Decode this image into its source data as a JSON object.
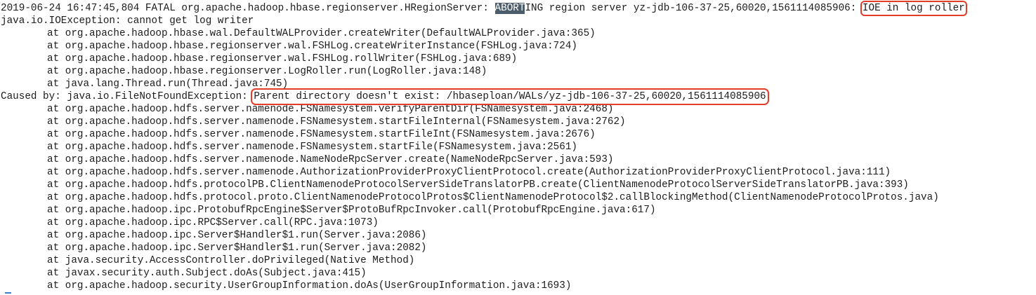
{
  "terminal": {
    "header": {
      "prefix": "2019-06-24 16:47:45,804 FATAL org.apache.hadoop.hbase.regionserver.HRegionServer: ",
      "selected": "ABORT",
      "middle": "ING region server yz-jdb-106-37-25,60020,1561114085906: ",
      "highlighted": "IOE in log roller"
    },
    "exception": "java.io.IOException: cannot get log writer",
    "trace1": [
      "at org.apache.hadoop.hbase.wal.DefaultWALProvider.createWriter(DefaultWALProvider.java:365)",
      "at org.apache.hadoop.hbase.regionserver.wal.FSHLog.createWriterInstance(FSHLog.java:724)",
      "at org.apache.hadoop.hbase.regionserver.wal.FSHLog.rollWriter(FSHLog.java:689)",
      "at org.apache.hadoop.hbase.regionserver.LogRoller.run(LogRoller.java:148)",
      "at java.lang.Thread.run(Thread.java:745)"
    ],
    "caused_by": {
      "prefix": "Caused by: java.io.FileNotFoundException: ",
      "highlighted": "Parent directory doesn't exist: /hbaseploan/WALs/yz-jdb-106-37-25,60020,1561114085906"
    },
    "trace2": [
      "at org.apache.hadoop.hdfs.server.namenode.FSNamesystem.verifyParentDir(FSNamesystem.java:2468)",
      "at org.apache.hadoop.hdfs.server.namenode.FSNamesystem.startFileInternal(FSNamesystem.java:2762)",
      "at org.apache.hadoop.hdfs.server.namenode.FSNamesystem.startFileInt(FSNamesystem.java:2676)",
      "at org.apache.hadoop.hdfs.server.namenode.FSNamesystem.startFile(FSNamesystem.java:2561)",
      "at org.apache.hadoop.hdfs.server.namenode.NameNodeRpcServer.create(NameNodeRpcServer.java:593)",
      "at org.apache.hadoop.hdfs.server.namenode.AuthorizationProviderProxyClientProtocol.create(AuthorizationProviderProxyClientProtocol.java:111)",
      "at org.apache.hadoop.hdfs.protocolPB.ClientNamenodeProtocolServerSideTranslatorPB.create(ClientNamenodeProtocolServerSideTranslatorPB.java:393)",
      "at org.apache.hadoop.hdfs.protocol.proto.ClientNamenodeProtocolProtos$ClientNamenodeProtocol$2.callBlockingMethod(ClientNamenodeProtocolProtos.java)",
      "at org.apache.hadoop.ipc.ProtobufRpcEngine$Server$ProtoBufRpcInvoker.call(ProtobufRpcEngine.java:617)",
      "at org.apache.hadoop.ipc.RPC$Server.call(RPC.java:1073)",
      "at org.apache.hadoop.ipc.Server$Handler$1.run(Server.java:2086)",
      "at org.apache.hadoop.ipc.Server$Handler$1.run(Server.java:2082)",
      "at java.security.AccessController.doPrivileged(Native Method)",
      "at javax.security.auth.Subject.doAs(Subject.java:415)",
      "at org.apache.hadoop.security.UserGroupInformation.doAs(UserGroupInformation.java:1693)"
    ]
  },
  "colors": {
    "text": "#1c1c1c",
    "selection": "#4d5d6b",
    "annotation_box": "#e53c2a",
    "cursor": "#3a7bd5"
  }
}
